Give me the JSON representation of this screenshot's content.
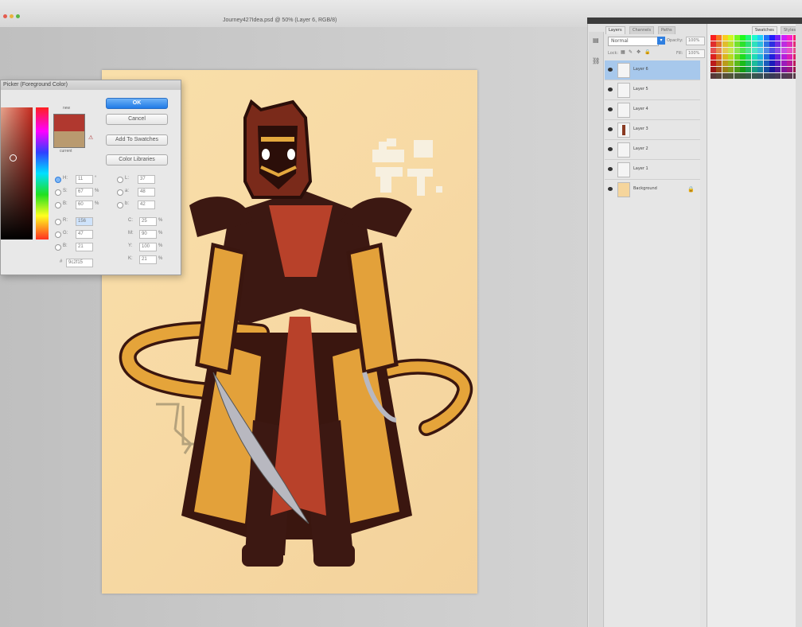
{
  "window": {
    "title": "Journey427Idea.psd @ 50% (Layer 6, RGB/8)"
  },
  "color_picker": {
    "title": "Picker (Foreground Color)",
    "new_label": "new",
    "current_label": "current",
    "new_color": "#b0382f",
    "current_color": "#b99a6f",
    "buttons": {
      "ok": "OK",
      "cancel": "Cancel",
      "add_to_swatches": "Add To Swatches",
      "color_libraries": "Color Libraries"
    },
    "hsb": [
      {
        "label": "H:",
        "value": "11",
        "unit": "°"
      },
      {
        "label": "S:",
        "value": "67",
        "unit": "%"
      },
      {
        "label": "B:",
        "value": "60",
        "unit": "%"
      }
    ],
    "rgb": [
      {
        "label": "R:",
        "value": "156"
      },
      {
        "label": "G:",
        "value": "47"
      },
      {
        "label": "B:",
        "value": "21"
      }
    ],
    "lab": [
      {
        "label": "L:",
        "value": "37"
      },
      {
        "label": "a:",
        "value": "48"
      },
      {
        "label": "b:",
        "value": "42"
      }
    ],
    "cmyk": [
      {
        "label": "C:",
        "value": "25",
        "unit": "%"
      },
      {
        "label": "M:",
        "value": "90",
        "unit": "%"
      },
      {
        "label": "Y:",
        "value": "100",
        "unit": "%"
      },
      {
        "label": "K:",
        "value": "21",
        "unit": "%"
      }
    ],
    "hex_label": "#",
    "hex": "9c2f15"
  },
  "layers_panel": {
    "tabs": [
      "Layers",
      "Channels",
      "Paths"
    ],
    "blend_mode": "Normal",
    "opacity_label": "Opacity:",
    "opacity": "100%",
    "lock_label": "Lock:",
    "fill_label": "Fill:",
    "fill": "100%",
    "layers": [
      {
        "name": "Layer 6",
        "selected": true
      },
      {
        "name": "Layer 5",
        "selected": false
      },
      {
        "name": "Layer 4",
        "selected": false
      },
      {
        "name": "Layer 3",
        "selected": false
      },
      {
        "name": "Layer 2",
        "selected": false
      },
      {
        "name": "Layer 1",
        "selected": false
      },
      {
        "name": "Background",
        "selected": false
      }
    ]
  },
  "swatches_panel": {
    "tabs": [
      "Swatches",
      "Styles"
    ]
  },
  "colors": {
    "canvas": "#f7d9a4",
    "character_dark": "#4a1a12",
    "character_red": "#b8412a",
    "character_gold": "#e7a637",
    "selection_blue": "#a7c8ec"
  }
}
